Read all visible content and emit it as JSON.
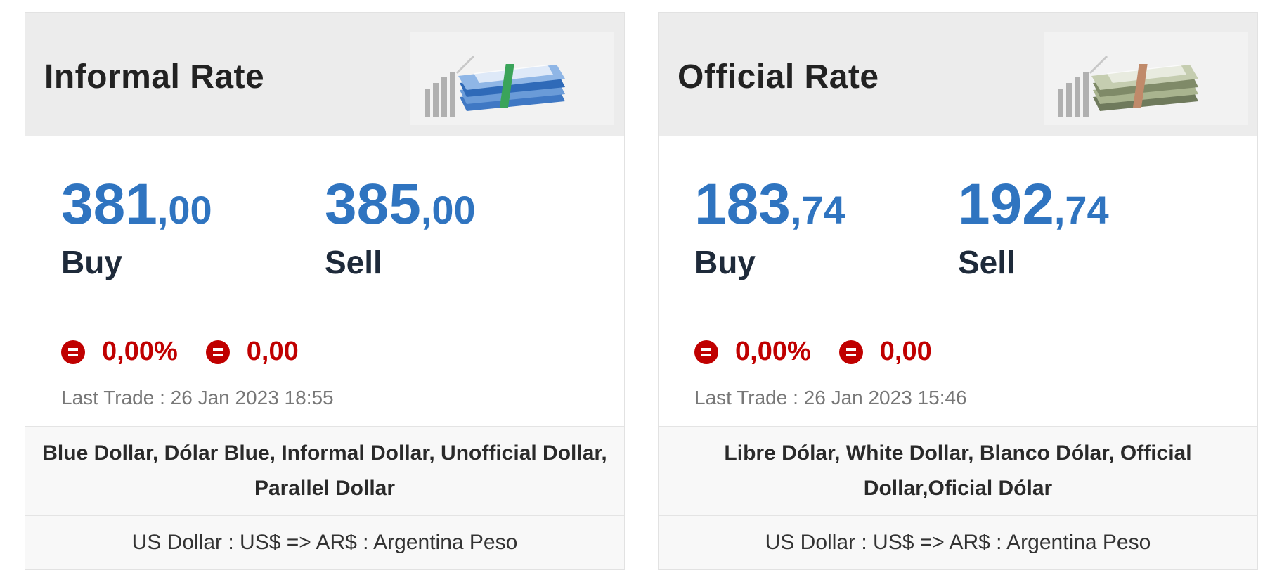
{
  "cards": [
    {
      "title": "Informal Rate",
      "icon": "dollar-stack-blue-icon",
      "buy": {
        "int": "381",
        "dec": ",00",
        "label": "Buy"
      },
      "sell": {
        "int": "385",
        "dec": ",00",
        "label": "Sell"
      },
      "change_percent": "0,00%",
      "change_value": "0,00",
      "last_trade": "Last Trade : 26 Jan 2023 18:55",
      "aliases": "Blue Dollar, Dólar Blue, Informal Dollar, Unofficial Dollar, Parallel Dollar",
      "currency_pair": "US Dollar : US$ => AR$ : Argentina Peso"
    },
    {
      "title": "Official Rate",
      "icon": "dollar-stack-green-icon",
      "buy": {
        "int": "183",
        "dec": ",74",
        "label": "Buy"
      },
      "sell": {
        "int": "192",
        "dec": ",74",
        "label": "Sell"
      },
      "change_percent": "0,00%",
      "change_value": "0,00",
      "last_trade": "Last Trade : 26 Jan 2023 15:46",
      "aliases": "Libre Dólar, White Dollar, Blanco Dólar, Official Dollar,Oficial Dólar",
      "currency_pair": "US Dollar : US$ => AR$ : Argentina Peso"
    }
  ],
  "colors": {
    "rate_blue": "#2f74c0",
    "change_red": "#c00000",
    "header_gray": "#ececec"
  }
}
